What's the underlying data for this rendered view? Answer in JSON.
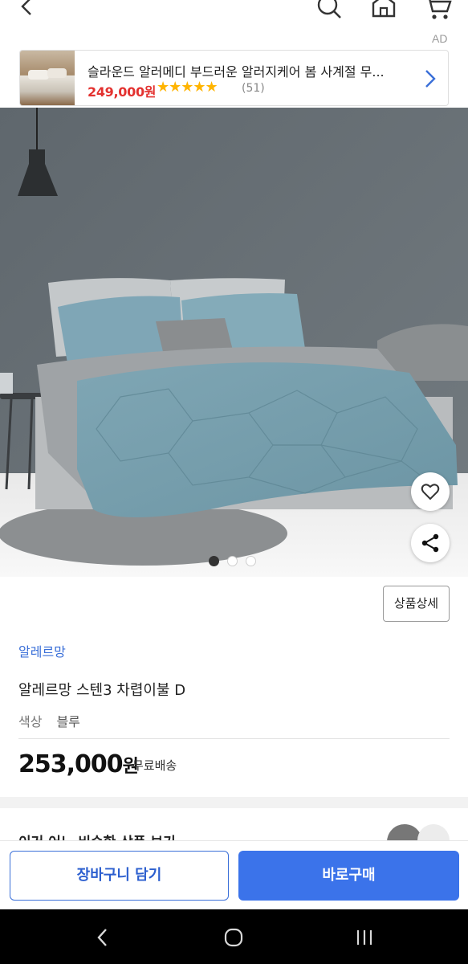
{
  "topbar": {
    "icons": [
      "back-icon",
      "search-icon",
      "home-icon",
      "cart-icon"
    ]
  },
  "ad": {
    "label": "AD",
    "title": "슬라운드 알러메디 부드러운 알러지케어 봄 사계절 무...",
    "price": "249,000원",
    "stars": "★★★★★",
    "review_count": "(51)",
    "rating": 5
  },
  "gallery": {
    "slide_count": 3,
    "active_slide": 1
  },
  "product": {
    "detail_button": "상품상세",
    "brand": "알레르망",
    "name": "알레르망 스텐3 차렵이불 D",
    "option_label": "색상",
    "option_value": "블루",
    "price_number": "253,000",
    "price_unit": "원",
    "shipping": "무료배송"
  },
  "similar": {
    "title": "이거 어느 비슷한 상품 보기"
  },
  "actions": {
    "cart_label": "장바구니 담기",
    "buy_label": "바로구매"
  },
  "colors": {
    "brand_blue": "#3b73ea",
    "price_red": "#e3312f",
    "star": "#ffb400"
  }
}
